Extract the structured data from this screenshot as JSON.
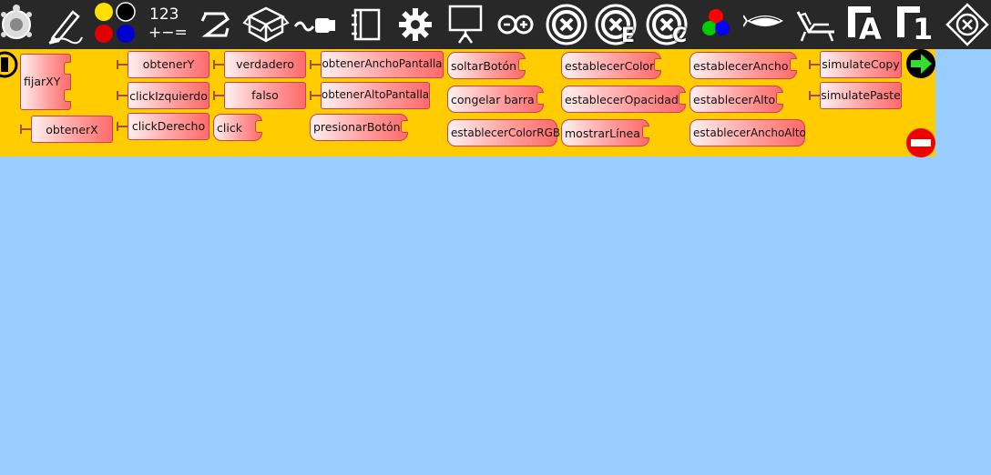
{
  "toolbar": {
    "number_label": "123",
    "operators_label": "+−=",
    "colors": {
      "yellow": "#ffe000",
      "black": "#000000",
      "red": "#e00000",
      "blue": "#0000cc"
    },
    "icons": [
      "turtle-icon",
      "pen-icon",
      "palette-colors-icon",
      "number-icon",
      "flow-icon",
      "box-icon",
      "sensor-icon",
      "notebook-icon",
      "settings-icon",
      "presentation-icon",
      "arduino-icon",
      "extras-icon",
      "extras-e-icon",
      "extras-c-icon",
      "rgb-icon",
      "fish-icon",
      "chair-icon",
      "font-a-icon",
      "font-1-icon",
      "clear-icon"
    ],
    "letter_e": "E",
    "letter_c": "C",
    "letter_a": "A",
    "digit_1": "1"
  },
  "palette": {
    "accent": "#ffcc00",
    "blocks": {
      "fijarXY": "fijarXY",
      "obtenerX": "obtenerX",
      "obtenerY": "obtenerY",
      "clickIzquierdo": "clickIzquierdo",
      "clickDerecho": "clickDerecho",
      "verdadero": "verdadero",
      "falso": "falso",
      "click": "click",
      "obtenerAnchoPantalla": "obtenerAnchoPantalla",
      "obtenerAltoPantalla": "obtenerAltoPantalla",
      "presionarBoton": "presionarBotón",
      "soltarBoton": "soltarBotón",
      "congelarBarra": "congelar barra",
      "establecerColorRGB": "establecerColorRGB",
      "establecerColor": "establecerColor",
      "establecerOpacidad": "establecerOpacidad",
      "mostrarLinea": "mostrarLínea",
      "establecerAncho": "establecerAncho",
      "establecerAlto": "establecerAlto",
      "establecerAnchoAlto": "establecerAnchoAlto",
      "simulateCopy": "simulateCopy",
      "simulatePaste": "simulatePaste"
    }
  }
}
